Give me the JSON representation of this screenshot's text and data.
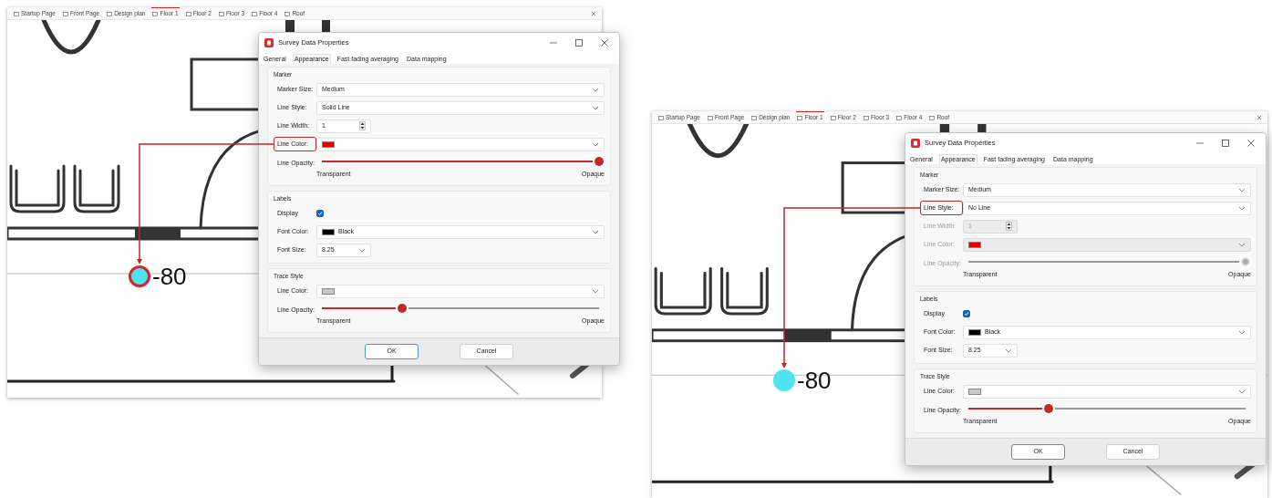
{
  "panels": [
    {
      "app_tabs": [
        {
          "label": "Startup Page",
          "selected": false
        },
        {
          "label": "Front Page",
          "selected": false
        },
        {
          "label": "Design plan",
          "selected": false
        },
        {
          "label": "Floor 1",
          "selected": true
        },
        {
          "label": "Floor 2",
          "selected": false
        },
        {
          "label": "Floor 3",
          "selected": false
        },
        {
          "label": "Floor 4",
          "selected": false
        },
        {
          "label": "Roof",
          "selected": false
        }
      ],
      "marker": {
        "reading": "-80",
        "outlined": true
      },
      "dialog": {
        "title": "Survey Data Properties",
        "tabs": [
          {
            "label": "General",
            "selected": false
          },
          {
            "label": "Appearance",
            "selected": true
          },
          {
            "label": "Fast fading averaging",
            "selected": false
          },
          {
            "label": "Data mapping",
            "selected": false
          }
        ],
        "sections": [
          {
            "title": "Marker",
            "rows": [
              {
                "kind": "select",
                "label": "Marker Size:",
                "value": "Medium",
                "disabled": false,
                "highlighted": false
              },
              {
                "kind": "select",
                "label": "Line Style:",
                "value": "Solid Line",
                "disabled": false,
                "highlighted": false
              },
              {
                "kind": "spin",
                "label": "Line Width:",
                "value": "1",
                "disabled": false,
                "highlighted": false
              },
              {
                "kind": "color",
                "label": "Line Color:",
                "color": "#e00000",
                "disabled": false,
                "highlighted": true
              },
              {
                "kind": "slider",
                "label": "Line Opacity:",
                "level": 1,
                "min_label": "Transparent",
                "max_label": "Opaque",
                "disabled": false,
                "highlighted": false
              }
            ]
          },
          {
            "title": "Labels",
            "rows": [
              {
                "kind": "checkbox",
                "label": "Display",
                "checked": true,
                "disabled": false,
                "highlighted": false
              },
              {
                "kind": "color",
                "label": "Font Color:",
                "color": "#000000",
                "value": "Black",
                "disabled": false,
                "highlighted": false
              },
              {
                "kind": "short_select",
                "label": "Font Size:",
                "value": "8.25",
                "disabled": false,
                "highlighted": false
              }
            ]
          },
          {
            "title": "Trace Style",
            "rows": [
              {
                "kind": "color",
                "label": "Line Color:",
                "color": "#c8c8c8",
                "disabled": false,
                "highlighted": false
              },
              {
                "kind": "slider",
                "label": "Line Opacity:",
                "level": 0.29,
                "min_label": "Transparent",
                "max_label": "Opaque",
                "disabled": false,
                "highlighted": false
              }
            ]
          }
        ],
        "buttons": [
          {
            "label": "OK",
            "default": true
          },
          {
            "label": "Cancel",
            "default": false
          }
        ]
      }
    },
    {
      "app_tabs": [
        {
          "label": "Startup Page",
          "selected": false
        },
        {
          "label": "Front Page",
          "selected": false
        },
        {
          "label": "Design plan",
          "selected": false
        },
        {
          "label": "Floor 1",
          "selected": true
        },
        {
          "label": "Floor 2",
          "selected": false
        },
        {
          "label": "Floor 3",
          "selected": false
        },
        {
          "label": "Floor 4",
          "selected": false
        },
        {
          "label": "Roof",
          "selected": false
        }
      ],
      "marker": {
        "reading": "-80",
        "outlined": false
      },
      "dialog": {
        "title": "Survey Data Properties",
        "tabs": [
          {
            "label": "General",
            "selected": false
          },
          {
            "label": "Appearance",
            "selected": true
          },
          {
            "label": "Fast fading averaging",
            "selected": false
          },
          {
            "label": "Data mapping",
            "selected": false
          }
        ],
        "sections": [
          {
            "title": "Marker",
            "rows": [
              {
                "kind": "select",
                "label": "Marker Size:",
                "value": "Medium",
                "disabled": false,
                "highlighted": false
              },
              {
                "kind": "select",
                "label": "Line Style:",
                "value": "No Line",
                "disabled": false,
                "highlighted": true
              },
              {
                "kind": "spin",
                "label": "Line Width:",
                "value": "1",
                "disabled": true,
                "highlighted": false
              },
              {
                "kind": "color",
                "label": "Line Color:",
                "color": "#e00000",
                "disabled": true,
                "highlighted": false
              },
              {
                "kind": "slider",
                "label": "Line Opacity:",
                "level": 1,
                "min_label": "Transparent",
                "max_label": "Opaque",
                "disabled": true,
                "highlighted": false
              }
            ]
          },
          {
            "title": "Labels",
            "rows": [
              {
                "kind": "checkbox",
                "label": "Display",
                "checked": true,
                "disabled": false,
                "highlighted": false
              },
              {
                "kind": "color",
                "label": "Font Color:",
                "color": "#000000",
                "value": "Black",
                "disabled": false,
                "highlighted": false
              },
              {
                "kind": "short_select",
                "label": "Font Size:",
                "value": "8.25",
                "disabled": false,
                "highlighted": false
              }
            ]
          },
          {
            "title": "Trace Style",
            "rows": [
              {
                "kind": "color",
                "label": "Line Color:",
                "color": "#c8c8c8",
                "disabled": false,
                "highlighted": false
              },
              {
                "kind": "slider",
                "label": "Line Opacity:",
                "level": 0.29,
                "min_label": "Transparent",
                "max_label": "Opaque",
                "disabled": false,
                "highlighted": false
              }
            ]
          }
        ],
        "buttons": [
          {
            "label": "OK",
            "default": true
          },
          {
            "label": "Cancel",
            "default": false
          }
        ]
      }
    }
  ]
}
